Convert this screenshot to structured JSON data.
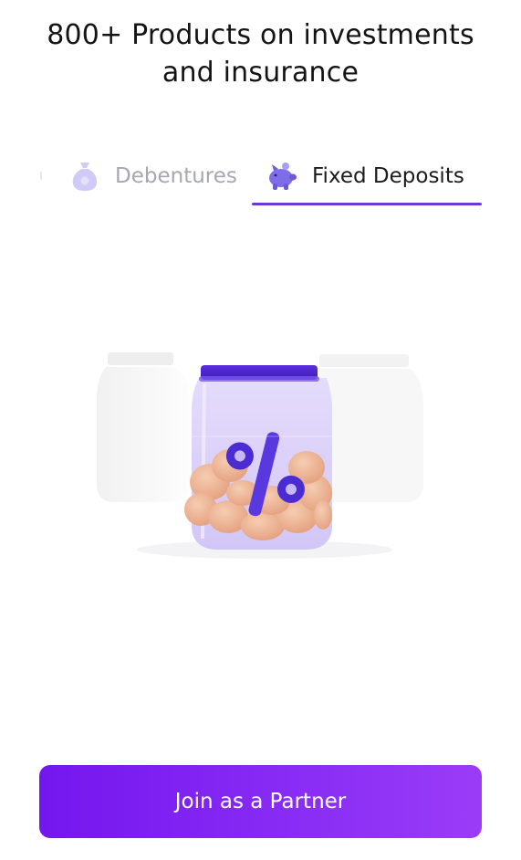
{
  "header": {
    "title_line1": "800+ Products on investments",
    "title_line2": "and insurance"
  },
  "tabs": [
    {
      "label": "Debentures",
      "icon": "money-bag-icon",
      "active": false
    },
    {
      "label": "Fixed Deposits",
      "icon": "piggy-bank-icon",
      "active": true
    }
  ],
  "illustration": {
    "main_icon": "percent-jar-icon",
    "symbol": "%"
  },
  "cta": {
    "label": "Join as a Partner"
  },
  "colors": {
    "accent": "#6f35d8",
    "cta_start": "#7416ef",
    "cta_end": "#9a3cf7",
    "inactive_text": "#a7a7b2",
    "icon_soft": "#c9c4f5"
  }
}
